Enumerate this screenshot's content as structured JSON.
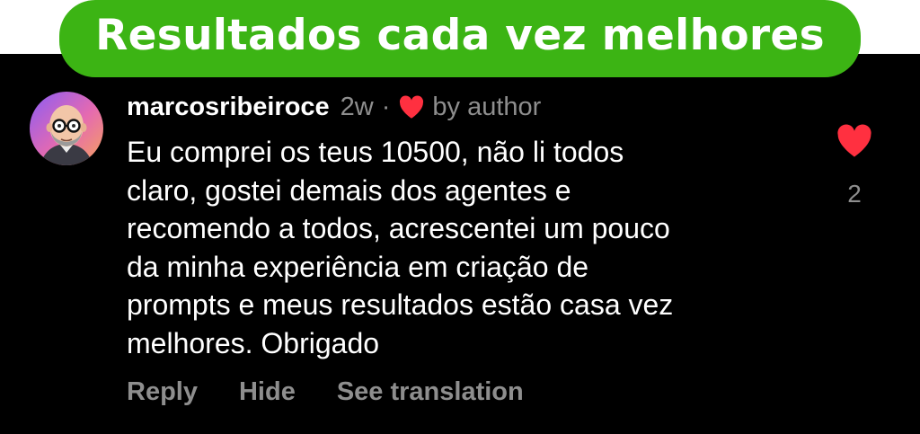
{
  "banner": {
    "text": "Resultados cada vez melhores",
    "color": "#3cb414"
  },
  "comment": {
    "username": "marcosribeiroce",
    "time": "2w",
    "separator": "·",
    "liked_by_author_icon": "heart-icon",
    "liked_by_author_label": "by author",
    "text_lines": [
      "Eu comprei os teus 10500, não li todos",
      "claro, gostei demais dos agentes e",
      "recomendo a todos, acrescentei um pouco",
      "da minha experiência em criação de",
      "prompts e meus resultados estão casa vez",
      "melhores. Obrigado"
    ],
    "like_icon": "heart-icon",
    "like_color": "#ff3040",
    "like_count": "2"
  },
  "actions": {
    "reply": "Reply",
    "hide": "Hide",
    "see_translation": "See translation"
  }
}
